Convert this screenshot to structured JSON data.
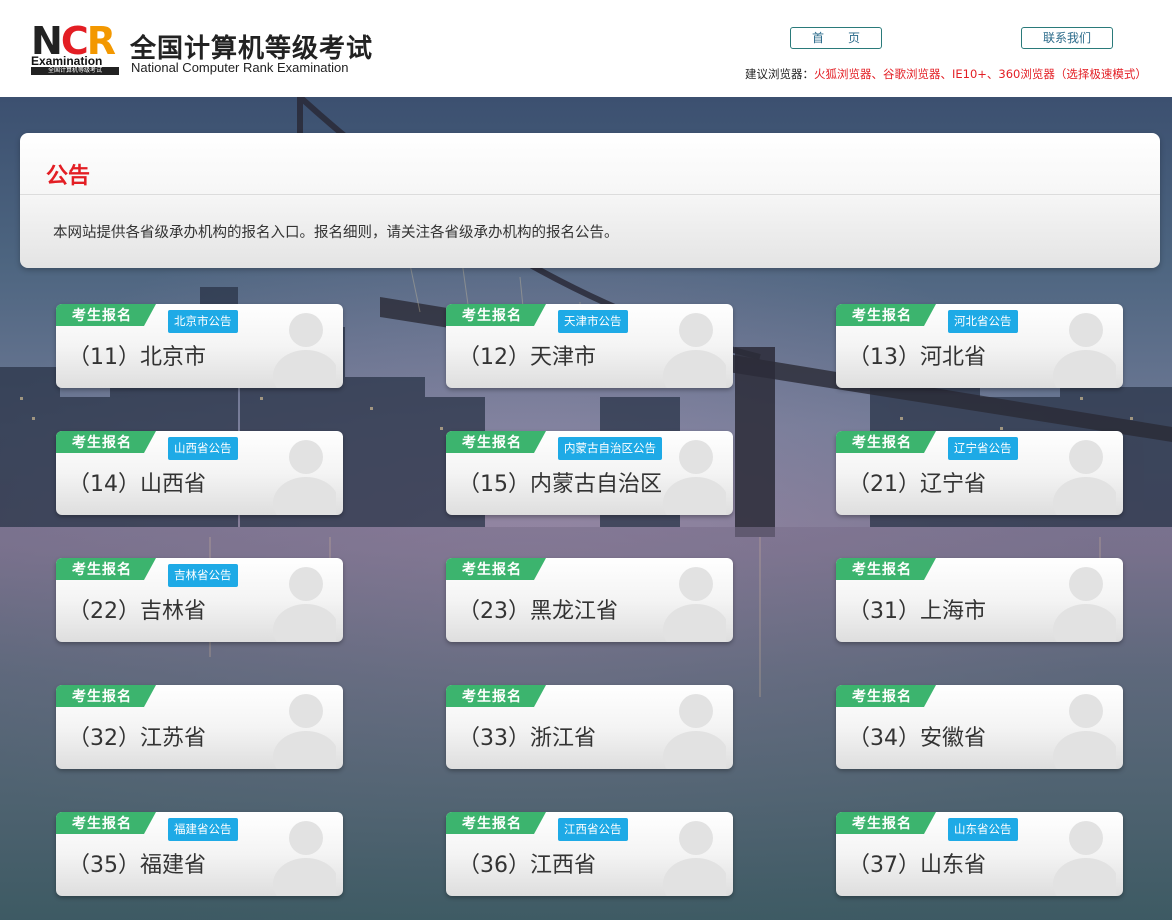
{
  "header": {
    "logo_letters": "NCR",
    "logo_word": "Examination",
    "logo_tagline": "全国计算机等级考试",
    "title_cn": "全国计算机等级考试",
    "title_en": "National Computer Rank Examination",
    "home_label": "首　　页",
    "contact_label": "联系我们",
    "browser_label": "建议浏览器：",
    "browser_value": "火狐浏览器、谷歌浏览器、IE10+、360浏览器（选择极速模式）"
  },
  "notice": {
    "title": "公告",
    "text": "本网站提供各省级承办机构的报名入口。报名细则，请关注各省级承办机构的报名公告。"
  },
  "colors": {
    "tag_green": "#3cb46e",
    "badge_blue": "#1eaae6",
    "title_red": "#e31e24"
  },
  "cards": [
    {
      "tag": "考生报名",
      "name": "（11）北京市",
      "badge": "北京市公告"
    },
    {
      "tag": "考生报名",
      "name": "（12）天津市",
      "badge": "天津市公告"
    },
    {
      "tag": "考生报名",
      "name": "（13）河北省",
      "badge": "河北省公告"
    },
    {
      "tag": "考生报名",
      "name": "（14）山西省",
      "badge": "山西省公告"
    },
    {
      "tag": "考生报名",
      "name": "（15）内蒙古自治区",
      "badge": "内蒙古自治区公告"
    },
    {
      "tag": "考生报名",
      "name": "（21）辽宁省",
      "badge": "辽宁省公告"
    },
    {
      "tag": "考生报名",
      "name": "（22）吉林省",
      "badge": "吉林省公告"
    },
    {
      "tag": "考生报名",
      "name": "（23）黑龙江省",
      "badge": ""
    },
    {
      "tag": "考生报名",
      "name": "（31）上海市",
      "badge": ""
    },
    {
      "tag": "考生报名",
      "name": "（32）江苏省",
      "badge": ""
    },
    {
      "tag": "考生报名",
      "name": "（33）浙江省",
      "badge": ""
    },
    {
      "tag": "考生报名",
      "name": "（34）安徽省",
      "badge": ""
    },
    {
      "tag": "考生报名",
      "name": "（35）福建省",
      "badge": "福建省公告"
    },
    {
      "tag": "考生报名",
      "name": "（36）江西省",
      "badge": "江西省公告"
    },
    {
      "tag": "考生报名",
      "name": "（37）山东省",
      "badge": "山东省公告"
    }
  ]
}
